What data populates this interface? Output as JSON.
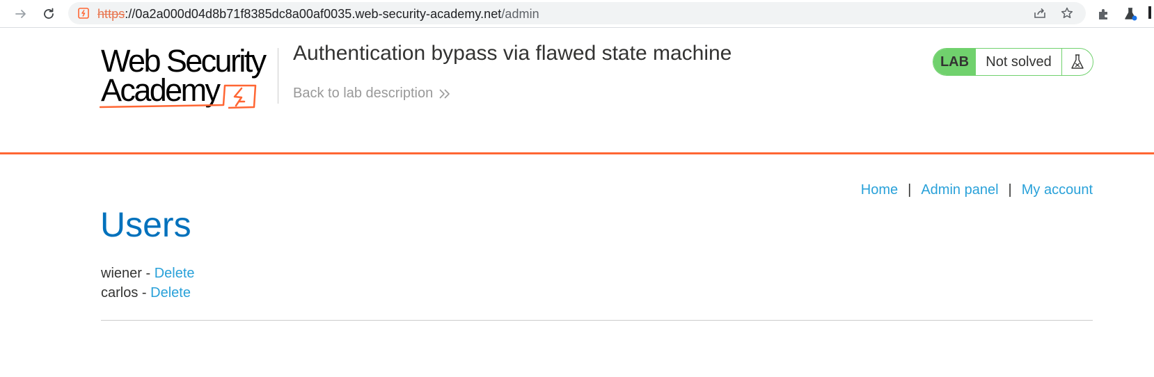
{
  "browser": {
    "url_scheme": "https",
    "url_host": "://0a2a000d04d8b71f8385dc8a00af0035.web-security-academy.net",
    "url_path": "/admin"
  },
  "header": {
    "logo_line1": "Web Security",
    "logo_line2": "Academy",
    "lab_title": "Authentication bypass via flawed state machine",
    "back_link": "Back to lab description",
    "status_tag": "LAB",
    "status_text": "Not solved"
  },
  "nav": {
    "home": "Home",
    "separator": "|",
    "admin_panel": "Admin panel",
    "my_account": "My account"
  },
  "main": {
    "heading": "Users",
    "users": [
      {
        "name": "wiener",
        "separator": " - ",
        "action": "Delete"
      },
      {
        "name": "carlos",
        "separator": " - ",
        "action": "Delete"
      }
    ]
  },
  "colors": {
    "accent_orange": "#ff6633",
    "link_blue": "#29a1d9",
    "heading_blue": "#0071bc",
    "status_green": "#70d16d"
  }
}
